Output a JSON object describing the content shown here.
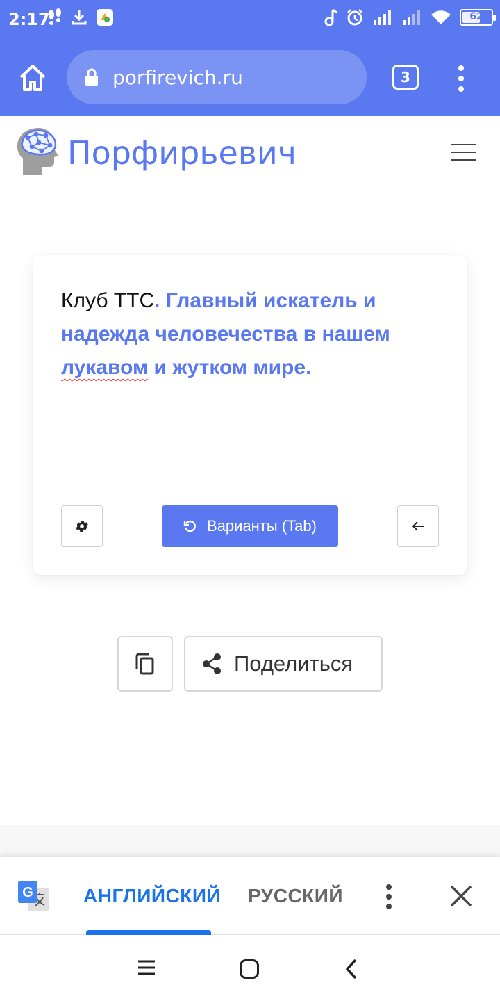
{
  "status_bar": {
    "time": "2:17",
    "battery": 62,
    "battery_label": "62"
  },
  "browser": {
    "url": "porfirevich.ru",
    "tab_count": "3",
    "icons": [
      "home-icon",
      "lock-icon",
      "tabs-icon",
      "more-vert-icon"
    ]
  },
  "site": {
    "title": "Порфирьевич",
    "icons": [
      "brain-head-logo",
      "hamburger-menu-icon"
    ]
  },
  "editor": {
    "plain_text": "Клуб ТТС",
    "generated_text_1": ". Главный искатель и надежда человечества в нашем ",
    "generated_text_misspelled": "лукавом",
    "generated_text_2": " и жутком мире.",
    "variants_button": "Варианты (Tab)",
    "icons": [
      "gear-icon",
      "refresh-icon",
      "arrow-left-icon"
    ]
  },
  "actions": {
    "share_label": "Поделиться",
    "icons": [
      "copy-icon",
      "share-icon"
    ]
  },
  "translate_bar": {
    "lang_source": "АНГЛИЙСКИЙ",
    "lang_target": "РУССКИЙ",
    "active_lang": "АНГЛИЙСКИЙ",
    "icons": [
      "google-translate-icon",
      "more-vert-icon",
      "close-icon"
    ]
  },
  "colors": {
    "accent": "#5a78f0",
    "translate_active": "#1a73e8",
    "spell_error": "#e53935"
  }
}
